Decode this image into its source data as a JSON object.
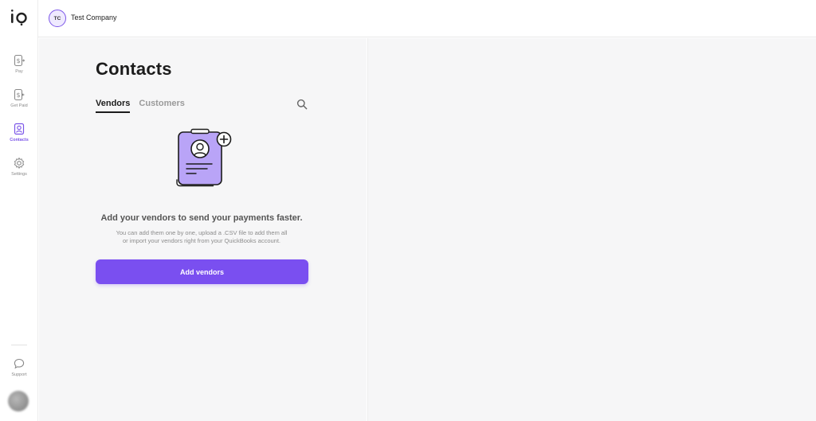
{
  "header": {
    "company_initials": "TC",
    "company_name": "Test Company"
  },
  "sidebar": {
    "items": [
      {
        "label": "Pay",
        "icon": "dollar-document-icon"
      },
      {
        "label": "Get Paid",
        "icon": "dollar-document-icon"
      },
      {
        "label": "Contacts",
        "icon": "contacts-icon",
        "active": true
      },
      {
        "label": "Settings",
        "icon": "gear-icon"
      }
    ],
    "support_label": "Support"
  },
  "main": {
    "title": "Contacts",
    "tabs": [
      {
        "label": "Vendors",
        "active": true
      },
      {
        "label": "Customers",
        "active": false
      }
    ],
    "empty_state": {
      "title": "Add your vendors to send your payments faster.",
      "description_line1": "You can add them one by one, upload a .CSV file to add them all",
      "description_line2": "or import your vendors right from your QuickBooks account.",
      "button_label": "Add vendors"
    }
  },
  "colors": {
    "accent": "#7a4ff0",
    "background": "#f6f6f7",
    "illustration_fill": "#b9a4f7"
  }
}
